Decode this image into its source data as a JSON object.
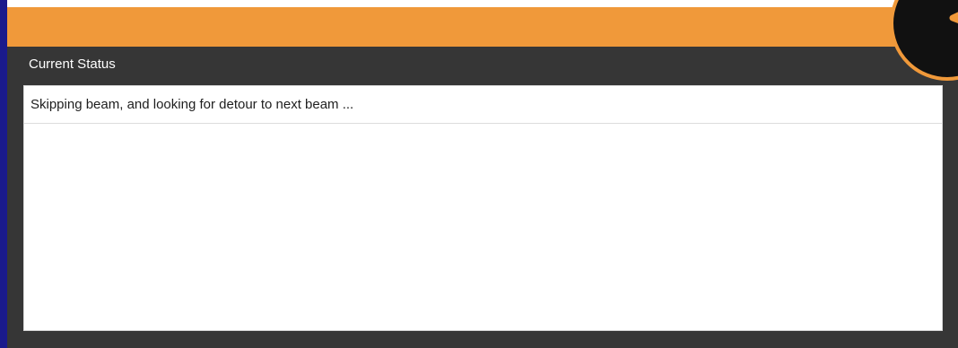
{
  "header": {
    "logo_icon": "clock-logo-icon",
    "banner_color": "#f0993a"
  },
  "status_panel": {
    "title": "Current Status",
    "background_color": "#363636",
    "items": [
      {
        "text": "Skipping beam, and looking for detour to next beam ..."
      }
    ]
  },
  "window": {
    "border_color": "#1a1a8c"
  }
}
